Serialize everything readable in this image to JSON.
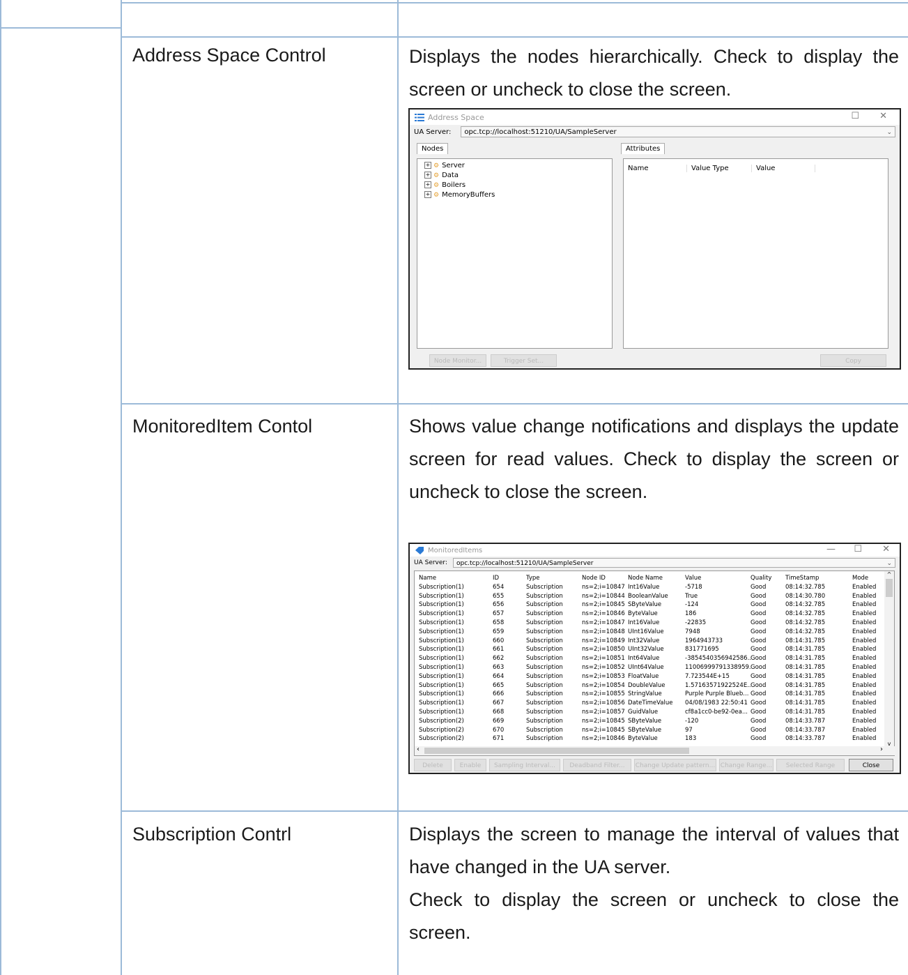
{
  "rows": [
    {
      "feature": "Address Space Control",
      "description": [
        "Displays the nodes hierarchically. Check to display the screen or uncheck to close the screen."
      ]
    },
    {
      "feature": "MonitoredItem Contol",
      "description": [
        "Shows value change notifications and displays the update screen for read values. Check to display the screen or uncheck to close the screen."
      ]
    },
    {
      "feature": "Subscription Contrl",
      "description": [
        "Displays the screen to manage the interval of values that have changed in the UA server.",
        "Check to display the screen or uncheck to close the screen."
      ]
    }
  ],
  "address_space_window": {
    "title": "Address Space",
    "server_label": "UA Server:",
    "server_value": "opc.tcp://localhost:51210/UA/SampleServer",
    "nodes_tab": "Nodes",
    "attributes_tab": "Attributes",
    "tree_items": [
      "Server",
      "Data",
      "Boilers",
      "MemoryBuffers"
    ],
    "attr_columns": [
      "Name",
      "Value Type",
      "Value"
    ],
    "buttons": [
      "Node Monitor...",
      "Trigger Set...",
      "Copy"
    ]
  },
  "monitored_window": {
    "title": "MonitoredItems",
    "server_label": "UA Server:",
    "server_value": "opc.tcp://localhost:51210/UA/SampleServer",
    "columns": [
      "Name",
      "ID",
      "Type",
      "Node ID",
      "Node Name",
      "Value",
      "Quality",
      "TimeStamp",
      "Mode"
    ],
    "rows": [
      [
        "Subscription(1)",
        "654",
        "Subscription",
        "ns=2;i=10847",
        "Int16Value",
        "-5718",
        "Good",
        "08:14:32.785",
        "Enabled"
      ],
      [
        "Subscription(1)",
        "655",
        "Subscription",
        "ns=2;i=10844",
        "BooleanValue",
        "True",
        "Good",
        "08:14:30.780",
        "Enabled"
      ],
      [
        "Subscription(1)",
        "656",
        "Subscription",
        "ns=2;i=10845",
        "SByteValue",
        "-124",
        "Good",
        "08:14:32.785",
        "Enabled"
      ],
      [
        "Subscription(1)",
        "657",
        "Subscription",
        "ns=2;i=10846",
        "ByteValue",
        "186",
        "Good",
        "08:14:32.785",
        "Enabled"
      ],
      [
        "Subscription(1)",
        "658",
        "Subscription",
        "ns=2;i=10847",
        "Int16Value",
        "-22835",
        "Good",
        "08:14:32.785",
        "Enabled"
      ],
      [
        "Subscription(1)",
        "659",
        "Subscription",
        "ns=2;i=10848",
        "UInt16Value",
        "7948",
        "Good",
        "08:14:32.785",
        "Enabled"
      ],
      [
        "Subscription(1)",
        "660",
        "Subscription",
        "ns=2;i=10849",
        "Int32Value",
        "1964943733",
        "Good",
        "08:14:31.785",
        "Enabled"
      ],
      [
        "Subscription(1)",
        "661",
        "Subscription",
        "ns=2;i=10850",
        "UInt32Value",
        "831771695",
        "Good",
        "08:14:31.785",
        "Enabled"
      ],
      [
        "Subscription(1)",
        "662",
        "Subscription",
        "ns=2;i=10851",
        "Int64Value",
        "-3854540356942586...",
        "Good",
        "08:14:31.785",
        "Enabled"
      ],
      [
        "Subscription(1)",
        "663",
        "Subscription",
        "ns=2;i=10852",
        "UInt64Value",
        "11006999791338959...",
        "Good",
        "08:14:31.785",
        "Enabled"
      ],
      [
        "Subscription(1)",
        "664",
        "Subscription",
        "ns=2;i=10853",
        "FloatValue",
        "7.723544E+15",
        "Good",
        "08:14:31.785",
        "Enabled"
      ],
      [
        "Subscription(1)",
        "665",
        "Subscription",
        "ns=2;i=10854",
        "DoubleValue",
        "1.57163571922524E...",
        "Good",
        "08:14:31.785",
        "Enabled"
      ],
      [
        "Subscription(1)",
        "666",
        "Subscription",
        "ns=2;i=10855",
        "StringValue",
        "Purple Purple Blueb...",
        "Good",
        "08:14:31.785",
        "Enabled"
      ],
      [
        "Subscription(1)",
        "667",
        "Subscription",
        "ns=2;i=10856",
        "DateTimeValue",
        "04/08/1983 22:50:41",
        "Good",
        "08:14:31.785",
        "Enabled"
      ],
      [
        "Subscription(1)",
        "668",
        "Subscription",
        "ns=2;i=10857",
        "GuidValue",
        "cf8a1cc0-be92-0ea...",
        "Good",
        "08:14:31.785",
        "Enabled"
      ],
      [
        "Subscription(2)",
        "669",
        "Subscription",
        "ns=2;i=10845",
        "SByteValue",
        "-120",
        "Good",
        "08:14:33.787",
        "Enabled"
      ],
      [
        "Subscription(2)",
        "670",
        "Subscription",
        "ns=2;i=10845",
        "SByteValue",
        "97",
        "Good",
        "08:14:33.787",
        "Enabled"
      ],
      [
        "Subscription(2)",
        "671",
        "Subscription",
        "ns=2;i=10846",
        "ByteValue",
        "183",
        "Good",
        "08:14:33.787",
        "Enabled"
      ]
    ],
    "buttons": [
      "Delete",
      "Enable",
      "Sampling Interval...",
      "Deadband Filter...",
      "Change Update pattern...",
      "Change Range...",
      "Selected Range",
      "Close"
    ]
  }
}
